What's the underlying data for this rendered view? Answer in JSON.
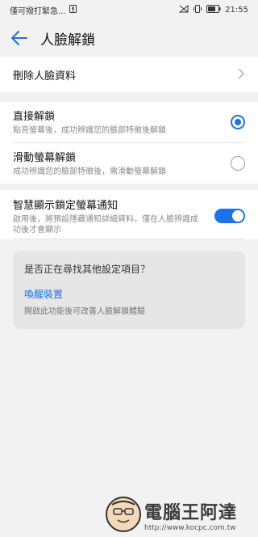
{
  "statusbar": {
    "notice": "僅可撥打緊急...",
    "time": "21:55"
  },
  "appbar": {
    "title": "人臉解鎖"
  },
  "rows": {
    "delete_face": "刪除人臉資料",
    "direct_unlock": {
      "label": "直接解鎖",
      "sub": "點亮螢幕後，成功辨識您的臉部特徵後解鎖",
      "selected": true
    },
    "slide_unlock": {
      "label": "滑動螢幕解鎖",
      "sub": "成功辨識您的臉部特徵後，需滑動螢幕解鎖",
      "selected": false
    },
    "smart_notify": {
      "label": "智慧顯示鎖定螢幕通知",
      "sub": "啟用後，將預設隱藏通知詳細資料，僅在人臉辨識成功後才會顯示",
      "enabled": true
    }
  },
  "suggest": {
    "question": "是否正在尋找其他設定項目？",
    "link": "喚醒裝置",
    "desc": "開啟此功能後可改善人臉解鎖體驗"
  },
  "watermark": {
    "brand": "電腦王阿達",
    "url": "http://www.kocpc.com.tw"
  },
  "colors": {
    "accent": "#1a73e8",
    "background": "#f2f2f2"
  }
}
